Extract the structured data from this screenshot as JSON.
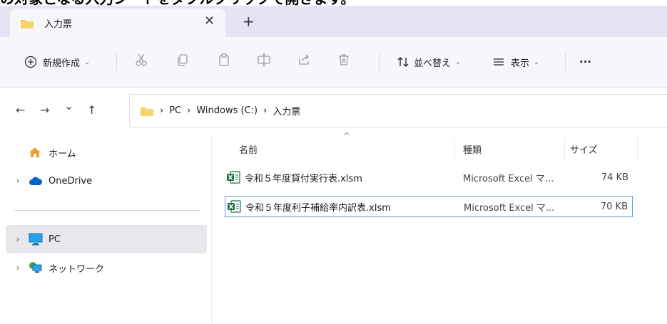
{
  "caption": "の対象となる入力シートをダブルクリックで開きます。",
  "tab": {
    "title": "入力票",
    "close": "✕",
    "new": "+"
  },
  "toolbar": {
    "new_label": "新規作成",
    "sort_label": "並べ替え",
    "view_label": "表示",
    "more_label": "···"
  },
  "nav": {
    "back": "←",
    "forward": "→",
    "recent": "⌄",
    "up": "↑"
  },
  "breadcrumb": [
    "PC",
    "Windows (C:)",
    "入力票"
  ],
  "breadcrumb_sep": "›",
  "sidebar": {
    "items": [
      {
        "label": "ホーム",
        "icon": "home-icon"
      },
      {
        "label": "OneDrive",
        "icon": "cloud-icon"
      },
      {
        "label": "PC",
        "icon": "monitor-icon"
      },
      {
        "label": "ネットワーク",
        "icon": "network-icon"
      }
    ],
    "expand_glyph": "›"
  },
  "columns": {
    "name": "名前",
    "type": "種類",
    "size": "サイズ",
    "sort_glyph": "^"
  },
  "files": [
    {
      "name": "令和５年度貸付実行表.xlsm",
      "type": "Microsoft Excel マ...",
      "size": "74 KB"
    },
    {
      "name": "令和５年度利子補給率内訳表.xlsm",
      "type": "Microsoft Excel マ...",
      "size": "70 KB"
    }
  ],
  "colors": {
    "accent": "#0067c0",
    "folder": "#f4c542",
    "excel": "#1d7044",
    "selection": "#5b9bd5"
  }
}
